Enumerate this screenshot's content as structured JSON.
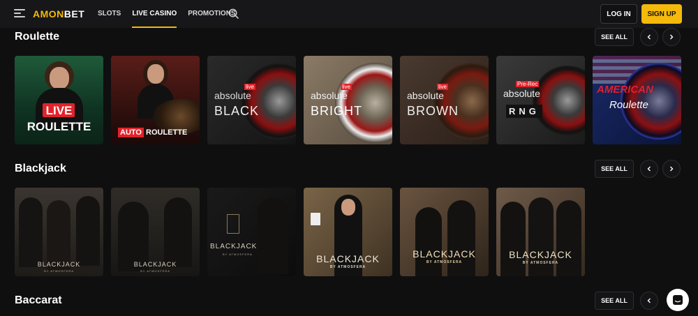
{
  "header": {
    "logo_part1": "AMON",
    "logo_part2": "BET",
    "nav": [
      "SLOTS",
      "LIVE CASINO",
      "PROMOTIONS"
    ],
    "login_label": "LOG IN",
    "signup_label": "SIGN UP"
  },
  "sections": [
    {
      "title": "Roulette",
      "see_all": "SEE ALL",
      "games": [
        {
          "line1": "LIVE",
          "line2": "ROULETTE"
        },
        {
          "line1": "AUTO",
          "line2": "ROULETTE"
        },
        {
          "line1": "absolute",
          "line2": "BLACK",
          "badge": "live"
        },
        {
          "line1": "absolute",
          "line2": "BRIGHT",
          "badge": "live"
        },
        {
          "line1": "absolute",
          "line2": "BROWN",
          "badge": "live"
        },
        {
          "line1": "absolute",
          "line2": "RNG",
          "badge": "Pre-Rec"
        },
        {
          "line1": "AMERICAN",
          "line2": "Roulette"
        }
      ]
    },
    {
      "title": "Blackjack",
      "see_all": "SEE ALL",
      "games": [
        {
          "line1": "BLACKJACK",
          "line2": "BY ATMOSFERA"
        },
        {
          "line1": "BLACKJACK",
          "line2": "BY ATMOSFERA"
        },
        {
          "line1": "BLACKJACK",
          "line2": "BY ATMOSFERA"
        },
        {
          "line1": "BLACKJACK",
          "line2": "BY ATMOSFERA"
        },
        {
          "line1": "BLACKJACK",
          "line2": "BY ATMOSFERA"
        },
        {
          "line1": "BLACKJACK",
          "line2": "BY ATMOSFERA"
        }
      ]
    },
    {
      "title": "Baccarat",
      "see_all": "SEE ALL"
    }
  ],
  "colors": {
    "accent": "#f4b90b",
    "background": "#0f0f10",
    "header": "#17171a"
  }
}
